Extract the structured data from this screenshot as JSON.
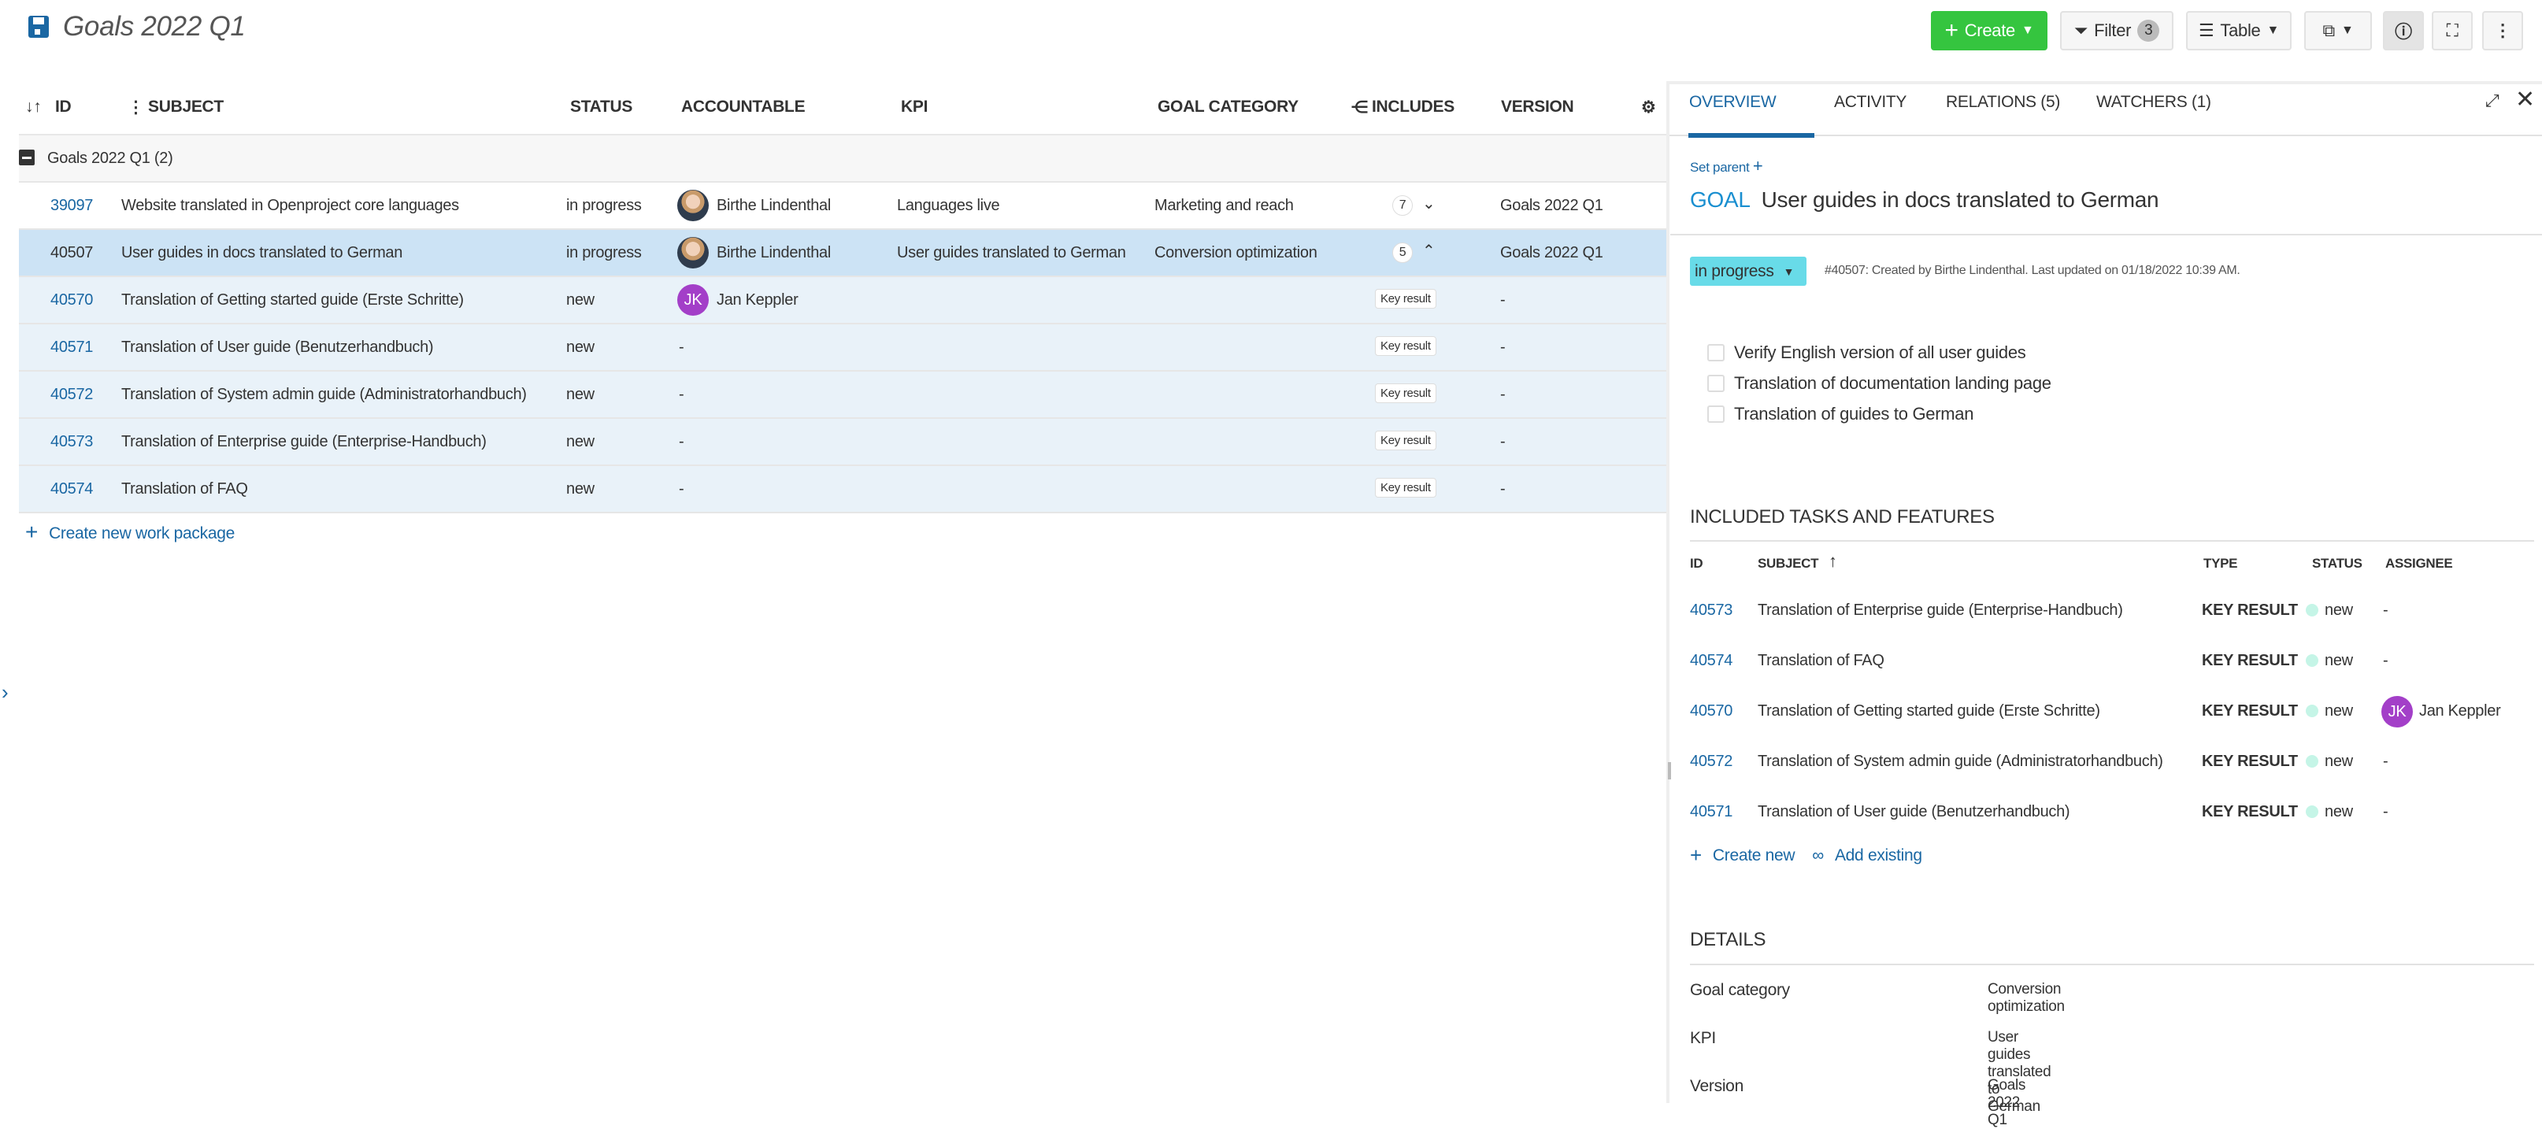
{
  "header": {
    "title": "Goals 2022 Q1",
    "create": "Create",
    "filter": "Filter",
    "filter_count": "3",
    "view": "Table"
  },
  "table": {
    "columns": [
      "ID",
      "SUBJECT",
      "STATUS",
      "ACCOUNTABLE",
      "KPI",
      "GOAL CATEGORY",
      "INCLUDES",
      "VERSION"
    ],
    "group": "Goals 2022 Q1 (2)",
    "rows": [
      {
        "id": "39097",
        "subject": "Website translated in Openproject core languages",
        "status": "in progress",
        "accountable": "Birthe Lindenthal",
        "avatar": "photo",
        "kpi": "Languages live",
        "category": "Marketing and reach",
        "includes": "7",
        "version": "Goals 2022 Q1",
        "kind": "parent"
      },
      {
        "id": "40507",
        "subject": "User guides in docs translated to German",
        "status": "in progress",
        "accountable": "Birthe Lindenthal",
        "avatar": "photo",
        "kpi": "User guides translated to German",
        "category": "Conversion optimization",
        "includes": "5",
        "version": "Goals 2022 Q1",
        "kind": "selected"
      },
      {
        "id": "40570",
        "subject": "Translation of Getting started guide (Erste Schritte)",
        "status": "new",
        "accountable": "Jan Keppler",
        "avatar": "JK",
        "kpi": "",
        "category": "",
        "includes": "Key result",
        "version": "-",
        "kind": "child"
      },
      {
        "id": "40571",
        "subject": "Translation of User guide (Benutzerhandbuch)",
        "status": "new",
        "accountable": "-",
        "kpi": "",
        "category": "",
        "includes": "Key result",
        "version": "-",
        "kind": "child"
      },
      {
        "id": "40572",
        "subject": "Translation of System admin guide (Administratorhandbuch)",
        "status": "new",
        "accountable": "-",
        "kpi": "",
        "category": "",
        "includes": "Key result",
        "version": "-",
        "kind": "child"
      },
      {
        "id": "40573",
        "subject": "Translation of Enterprise guide (Enterprise-Handbuch)",
        "status": "new",
        "accountable": "-",
        "kpi": "",
        "category": "",
        "includes": "Key result",
        "version": "-",
        "kind": "child"
      },
      {
        "id": "40574",
        "subject": "Translation of FAQ",
        "status": "new",
        "accountable": "-",
        "kpi": "",
        "category": "",
        "includes": "Key result",
        "version": "-",
        "kind": "child"
      }
    ],
    "create_new": "Create new work package"
  },
  "panel": {
    "tabs": [
      "OVERVIEW",
      "ACTIVITY",
      "RELATIONS (5)",
      "WATCHERS (1)"
    ],
    "set_parent": "Set parent",
    "type": "GOAL",
    "subject": "User guides in docs translated to German",
    "status": "in progress",
    "meta": "#40507: Created by Birthe Lindenthal. Last updated on 01/18/2022 10:39 AM.",
    "checklist": [
      "Verify English version of all user guides",
      "Translation of documentation landing page",
      "Translation of guides to German"
    ],
    "included_title": "INCLUDED TASKS AND FEATURES",
    "included_cols": [
      "ID",
      "SUBJECT",
      "TYPE",
      "STATUS",
      "ASSIGNEE"
    ],
    "included": [
      {
        "id": "40573",
        "subject": "Translation of Enterprise guide (Enterprise-Handbuch)",
        "type": "KEY RESULT",
        "status": "new",
        "assignee": "-"
      },
      {
        "id": "40574",
        "subject": "Translation of FAQ",
        "type": "KEY RESULT",
        "status": "new",
        "assignee": "-"
      },
      {
        "id": "40570",
        "subject": "Translation of Getting started guide (Erste Schritte)",
        "type": "KEY RESULT",
        "status": "new",
        "assignee": "Jan Keppler",
        "initials": "JK"
      },
      {
        "id": "40572",
        "subject": "Translation of System admin guide (Administratorhandbuch)",
        "type": "KEY RESULT",
        "status": "new",
        "assignee": "-"
      },
      {
        "id": "40571",
        "subject": "Translation of User guide (Benutzerhandbuch)",
        "type": "KEY RESULT",
        "status": "new",
        "assignee": "-"
      }
    ],
    "create_new": "Create new",
    "add_existing": "Add existing",
    "details_title": "DETAILS",
    "details": [
      {
        "label": "Goal category",
        "value": "Conversion optimization"
      },
      {
        "label": "KPI",
        "value": "User guides translated to German"
      },
      {
        "label": "Version",
        "value": "Goals 2022 Q1"
      }
    ]
  },
  "colors": {
    "link": "#1a67a3",
    "create": "#35c53f",
    "selected_row": "#cce3f5",
    "child_row": "#e9f2f9",
    "status_badge": "#68dbe8",
    "avatar_jk": "#a33fc8"
  }
}
